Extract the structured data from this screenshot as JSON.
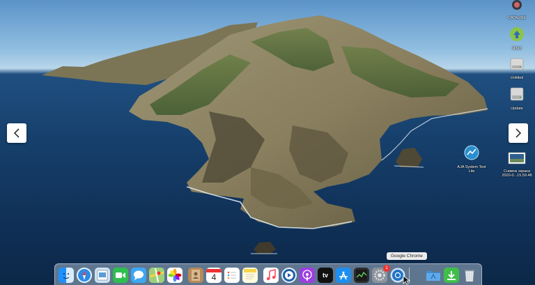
{
  "desktop": {
    "icons": [
      {
        "id": "catalina-installer",
        "label": "CATALINE"
      },
      {
        "id": "android-file",
        "label": "ЯЗКЗ"
      },
      {
        "id": "untitled-drive",
        "label": "Untitled"
      },
      {
        "id": "update-drive",
        "label": "Update"
      },
      {
        "id": "aja-system-test",
        "label": "AJA System Test Lite"
      },
      {
        "id": "screen-recording",
        "label": "Снимок экрана 2020-0...15.59.48"
      }
    ]
  },
  "navigation": {
    "prev_label": "‹",
    "next_label": "›"
  },
  "tooltip": {
    "text": "Google Chrome"
  },
  "dock": {
    "apps": [
      {
        "id": "finder",
        "icon": "finder-icon"
      },
      {
        "id": "safari",
        "icon": "safari-icon"
      },
      {
        "id": "preview",
        "icon": "preview-icon"
      },
      {
        "id": "facetime",
        "icon": "facetime-icon"
      },
      {
        "id": "messages",
        "icon": "messages-icon"
      },
      {
        "id": "maps",
        "icon": "maps-icon"
      },
      {
        "id": "photos",
        "icon": "photos-icon"
      },
      {
        "id": "contacts",
        "icon": "contacts-icon"
      },
      {
        "id": "calendar",
        "icon": "calendar-icon",
        "day": "4"
      },
      {
        "id": "reminders",
        "icon": "reminders-icon"
      },
      {
        "id": "notes",
        "icon": "notes-icon"
      },
      {
        "id": "music",
        "icon": "music-icon"
      },
      {
        "id": "quicktime",
        "icon": "quicktime-icon"
      },
      {
        "id": "podcasts",
        "icon": "podcasts-icon"
      },
      {
        "id": "apple-tv",
        "icon": "apple-tv-icon",
        "label": "tv"
      },
      {
        "id": "app-store",
        "icon": "app-store-icon"
      },
      {
        "id": "activity-monitor",
        "icon": "activity-monitor-icon"
      },
      {
        "id": "system-preferences",
        "icon": "system-preferences-icon",
        "badge": "1"
      },
      {
        "id": "google-chrome",
        "icon": "chrome-icon"
      },
      {
        "id": "applications-folder",
        "icon": "applications-folder-icon"
      },
      {
        "id": "downloads-folder",
        "icon": "downloads-folder-icon"
      },
      {
        "id": "trash",
        "icon": "trash-icon"
      }
    ]
  },
  "colors": {
    "sky": "#8fbde0",
    "sea": "#163f6b",
    "island": "#8a8563",
    "vegetation": "#4f6a36",
    "dock": "#d2e1ee"
  }
}
